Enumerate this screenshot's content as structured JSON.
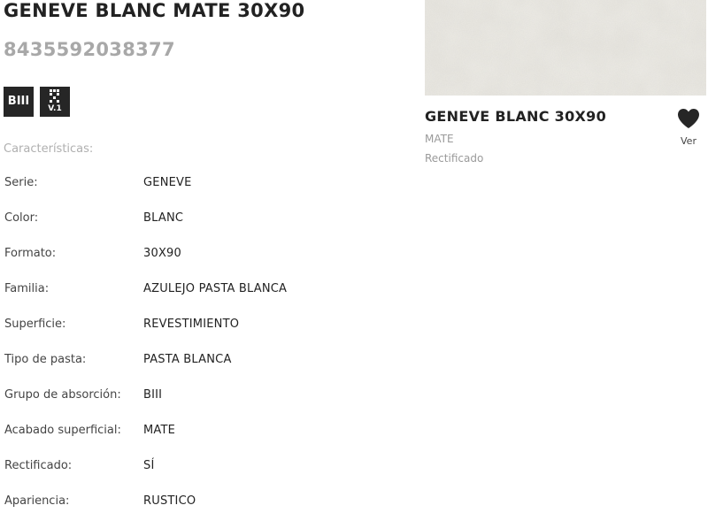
{
  "product": {
    "title": "GENEVE BLANC MATE 30X90",
    "ean": "8435592038377"
  },
  "badges": [
    {
      "icon": "biii-absorption-icon",
      "label": "BIII"
    },
    {
      "icon": "pattern-variation-icon",
      "label": "V.1"
    }
  ],
  "specs": {
    "heading": "Características:",
    "rows": [
      {
        "label": "Serie:",
        "value": "GENEVE"
      },
      {
        "label": "Color:",
        "value": "BLANC"
      },
      {
        "label": "Formato:",
        "value": "30X90"
      },
      {
        "label": "Familia:",
        "value": "AZULEJO PASTA BLANCA"
      },
      {
        "label": "Superficie:",
        "value": "REVESTIMIENTO"
      },
      {
        "label": "Tipo de pasta:",
        "value": "PASTA BLANCA"
      },
      {
        "label": "Grupo de absorción:",
        "value": "BIII"
      },
      {
        "label": "Acabado superficial:",
        "value": "MATE"
      },
      {
        "label": "Rectificado:",
        "value": "SÍ"
      },
      {
        "label": "Apariencia:",
        "value": "RUSTICO"
      }
    ]
  },
  "card": {
    "title": "GENEVE BLANC 30X90",
    "finish": "MATE",
    "rectified": "Rectificado",
    "favorite_label": "Ver",
    "favorite_icon": "heart-icon",
    "image_color": "#e7e5df"
  }
}
